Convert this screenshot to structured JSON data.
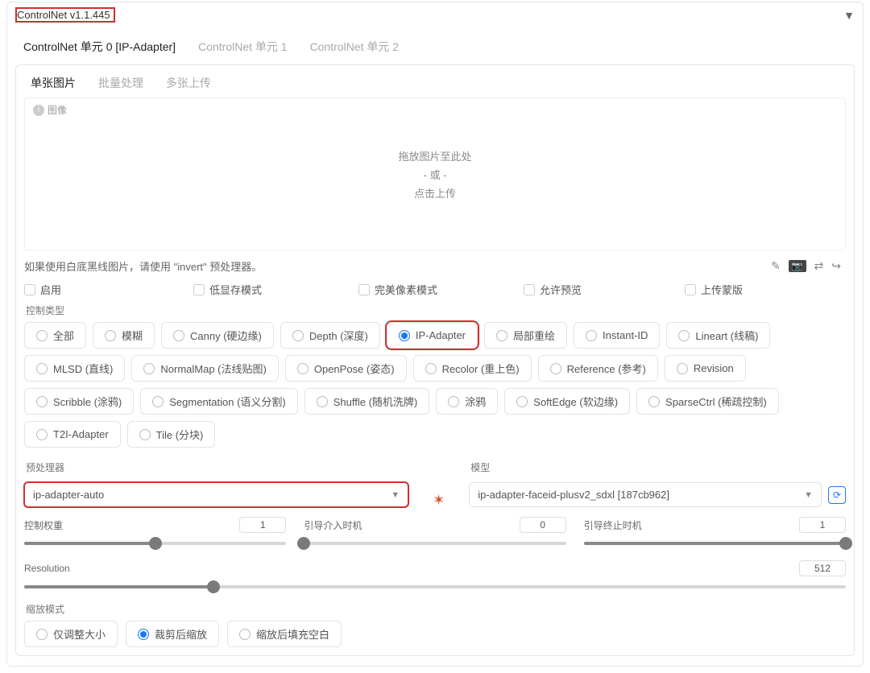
{
  "header": {
    "title": "ControlNet v1.1.445"
  },
  "unit_tabs": [
    {
      "label": "ControlNet 单元 0 [IP-Adapter]",
      "active": true
    },
    {
      "label": "ControlNet 单元 1",
      "active": false
    },
    {
      "label": "ControlNet 单元 2",
      "active": false
    }
  ],
  "sub_tabs": [
    {
      "label": "单张图片",
      "active": true
    },
    {
      "label": "批量处理",
      "active": false
    },
    {
      "label": "多张上传",
      "active": false
    }
  ],
  "drop_zone": {
    "corner_label": "图像",
    "line1": "拖放图片至此处",
    "line2": "- 或 -",
    "line3": "点击上传"
  },
  "hint": "如果使用白底黑线图片，请使用 \"invert\" 预处理器。",
  "checkboxes": [
    {
      "label": "启用"
    },
    {
      "label": "低显存模式"
    },
    {
      "label": "完美像素模式"
    },
    {
      "label": "允许预览"
    },
    {
      "label": "上传蒙版"
    }
  ],
  "control_type": {
    "label": "控制类型",
    "options": [
      "全部",
      "模糊",
      "Canny (硬边缘)",
      "Depth (深度)",
      "IP-Adapter",
      "局部重绘",
      "Instant-ID",
      "Lineart (线稿)",
      "MLSD (直线)",
      "NormalMap (法线贴图)",
      "OpenPose (姿态)",
      "Recolor (重上色)",
      "Reference (参考)",
      "Revision",
      "Scribble (涂鸦)",
      "Segmentation (语义分割)",
      "Shuffle (随机洗牌)",
      "涂鸦",
      "SoftEdge (软边缘)",
      "SparseCtrl (稀疏控制)",
      "T2I-Adapter",
      "Tile (分块)"
    ],
    "selected_index": 4
  },
  "preprocessor": {
    "label": "预处理器",
    "value": "ip-adapter-auto"
  },
  "model": {
    "label": "模型",
    "value": "ip-adapter-faceid-plusv2_sdxl [187cb962]"
  },
  "sliders": {
    "weight": {
      "label": "控制权重",
      "value": 1,
      "min": 0,
      "max": 2,
      "pos": 0.5
    },
    "start": {
      "label": "引导介入时机",
      "value": 0,
      "min": 0,
      "max": 1,
      "pos": 0.0
    },
    "end": {
      "label": "引导终止时机",
      "value": 1,
      "min": 0,
      "max": 1,
      "pos": 1.0
    },
    "resolution": {
      "label": "Resolution",
      "value": 512,
      "min": 64,
      "max": 2048,
      "pos": 0.23
    }
  },
  "resize_mode": {
    "label": "缩放模式",
    "options": [
      "仅调整大小",
      "裁剪后缩放",
      "缩放后填充空白"
    ],
    "selected_index": 1
  }
}
